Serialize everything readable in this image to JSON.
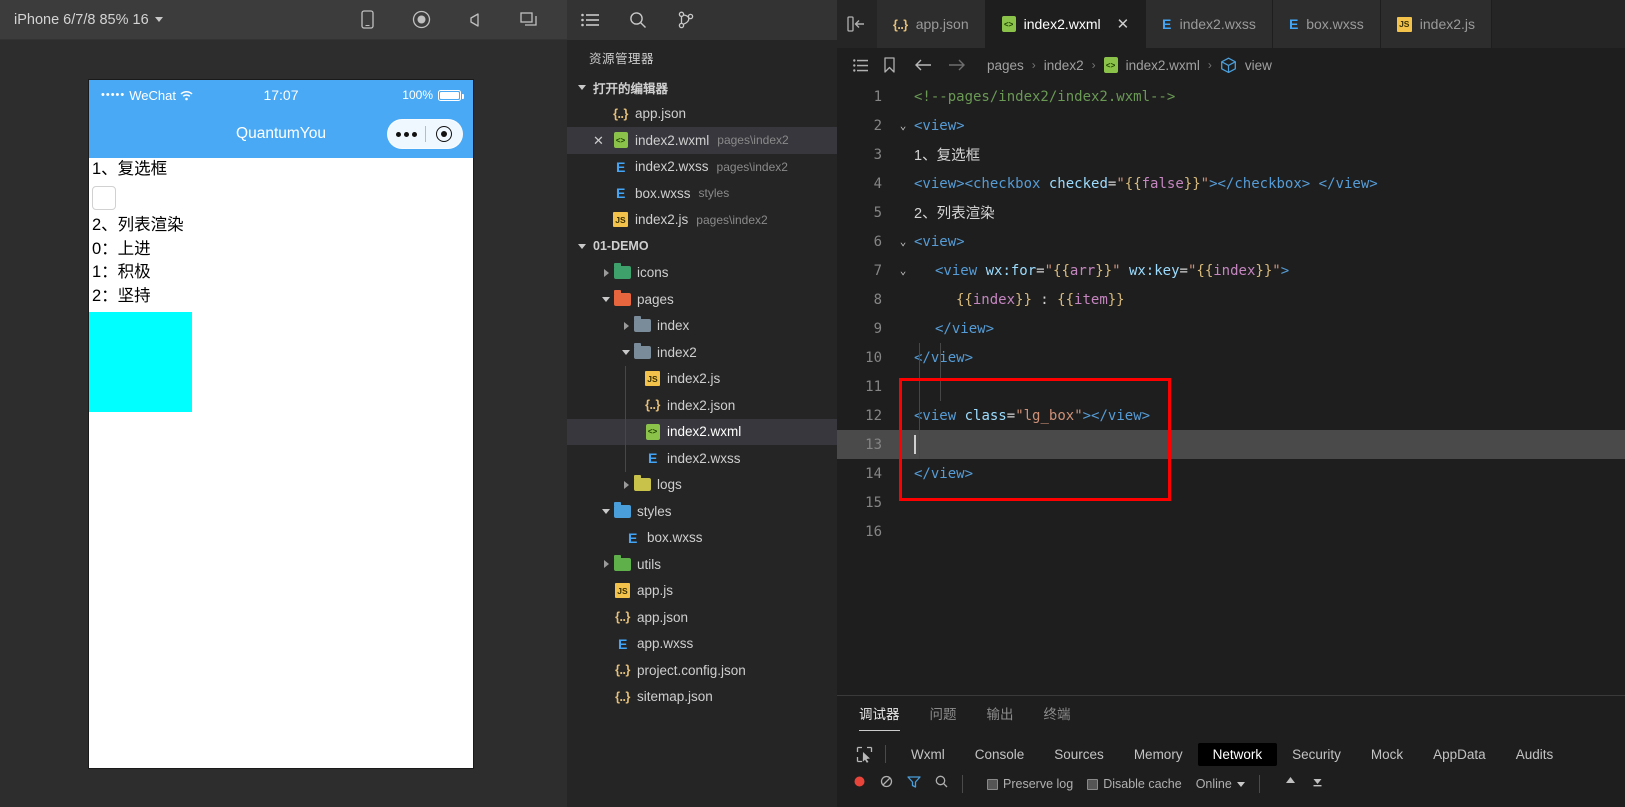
{
  "simulator": {
    "device_label": "iPhone 6/7/8 85% 16",
    "toolbar_icons": [
      "phone-icon",
      "record-icon",
      "volume-icon",
      "windows-icon"
    ],
    "phone": {
      "status": {
        "dots": "•••••",
        "carrier": "WeChat",
        "wifi": "ᵛ",
        "time": "17:07",
        "battery": "100%"
      },
      "nav": {
        "title": "QuantumYou"
      },
      "content": {
        "heading1": "1、复选框",
        "heading2": "2、列表渲染",
        "list": [
          "0：上进",
          "1：积极",
          "2：坚持"
        ]
      }
    }
  },
  "explorer": {
    "activity_icons": [
      "list-icon",
      "search-icon",
      "source-control-icon"
    ],
    "collapse_icon": "collapse-sidebar-icon",
    "title": "资源管理器",
    "open_editors": {
      "label": "打开的编辑器",
      "items": [
        {
          "name": "app.json",
          "detail": "",
          "icon": "json-icon",
          "selected": false,
          "close": false
        },
        {
          "name": "index2.wxml",
          "detail": "pages\\index2",
          "icon": "wxml-icon",
          "selected": true,
          "close": true
        },
        {
          "name": "index2.wxss",
          "detail": "pages\\index2",
          "icon": "wxss-icon",
          "selected": false,
          "close": false
        },
        {
          "name": "box.wxss",
          "detail": "styles",
          "icon": "wxss-icon",
          "selected": false,
          "close": false
        },
        {
          "name": "index2.js",
          "detail": "pages\\index2",
          "icon": "js-icon",
          "selected": false,
          "close": false
        }
      ]
    },
    "project": {
      "label": "01-DEMO",
      "items": [
        {
          "name": "icons",
          "type": "folder",
          "indent": 1,
          "state": "collapsed",
          "color": "#3ea06a",
          "icon": "folder-icons"
        },
        {
          "name": "pages",
          "type": "folder",
          "indent": 1,
          "state": "expanded",
          "color": "#e8663d",
          "icon": "folder-pages"
        },
        {
          "name": "index",
          "type": "folder",
          "indent": 2,
          "state": "collapsed",
          "color": "#7a8b9a",
          "icon": "folder-index"
        },
        {
          "name": "index2",
          "type": "folder",
          "indent": 2,
          "state": "expanded",
          "color": "#7a8b9a",
          "icon": "folder-index2"
        },
        {
          "name": "index2.js",
          "type": "js",
          "indent": 3,
          "state": "none",
          "icon": "js-icon"
        },
        {
          "name": "index2.json",
          "type": "json",
          "indent": 3,
          "state": "none",
          "icon": "json-icon"
        },
        {
          "name": "index2.wxml",
          "type": "wxml",
          "indent": 3,
          "state": "none",
          "icon": "wxml-icon",
          "selected": true
        },
        {
          "name": "index2.wxss",
          "type": "wxss",
          "indent": 3,
          "state": "none",
          "icon": "wxss-icon"
        },
        {
          "name": "logs",
          "type": "folder",
          "indent": 2,
          "state": "collapsed",
          "color": "#c9c24a",
          "icon": "folder-logs"
        },
        {
          "name": "styles",
          "type": "folder",
          "indent": 1,
          "state": "expanded",
          "color": "#4a9eda",
          "icon": "folder-styles"
        },
        {
          "name": "box.wxss",
          "type": "wxss",
          "indent": 2,
          "state": "none",
          "icon": "wxss-icon"
        },
        {
          "name": "utils",
          "type": "folder",
          "indent": 1,
          "state": "collapsed",
          "color": "#5fb04a",
          "icon": "folder-utils"
        },
        {
          "name": "app.js",
          "type": "js",
          "indent": 1,
          "state": "none",
          "icon": "js-icon"
        },
        {
          "name": "app.json",
          "type": "json",
          "indent": 1,
          "state": "none",
          "icon": "json-icon"
        },
        {
          "name": "app.wxss",
          "type": "wxss",
          "indent": 1,
          "state": "none",
          "icon": "wxss-icon"
        },
        {
          "name": "project.config.json",
          "type": "json",
          "indent": 1,
          "state": "none",
          "icon": "json-icon"
        },
        {
          "name": "sitemap.json",
          "type": "json",
          "indent": 1,
          "state": "none",
          "icon": "json-icon"
        }
      ]
    }
  },
  "editor": {
    "tabs": [
      {
        "label": "app.json",
        "icon": "json-icon",
        "active": false,
        "closable": false
      },
      {
        "label": "index2.wxml",
        "icon": "wxml-icon",
        "active": true,
        "closable": true,
        "close_glyph": "✕"
      },
      {
        "label": "index2.wxss",
        "icon": "wxss-icon",
        "active": false,
        "closable": false
      },
      {
        "label": "box.wxss",
        "icon": "wxss-icon",
        "active": false,
        "closable": false
      },
      {
        "label": "index2.js",
        "icon": "js-icon",
        "active": false,
        "closable": false
      }
    ],
    "breadcrumb": {
      "icons": [
        "outline-icon",
        "bookmark-icon",
        "back-arrow-icon",
        "forward-arrow-icon"
      ],
      "path": [
        "pages",
        "index2",
        "index2.wxml",
        "view"
      ],
      "separator": "›"
    },
    "code_lines": [
      {
        "n": 1,
        "fold": "",
        "indent": 0,
        "tokens": [
          {
            "t": "cmt",
            "v": "<!--pages/index2/index2.wxml-->"
          }
        ]
      },
      {
        "n": 2,
        "fold": "v",
        "indent": 0,
        "tokens": [
          {
            "t": "tag",
            "v": "<view>"
          }
        ]
      },
      {
        "n": 3,
        "fold": "",
        "indent": 0,
        "tokens": [
          {
            "t": "txt",
            "v": "1、复选框"
          }
        ]
      },
      {
        "n": 4,
        "fold": "",
        "indent": 0,
        "tokens": [
          {
            "t": "tag",
            "v": "<view><checkbox"
          },
          {
            "t": "txt",
            "v": " "
          },
          {
            "t": "attr",
            "v": "checked"
          },
          {
            "t": "punc",
            "v": "="
          },
          {
            "t": "str",
            "v": "\""
          },
          {
            "t": "brace",
            "v": "{{"
          },
          {
            "t": "kw",
            "v": "false"
          },
          {
            "t": "brace",
            "v": "}}"
          },
          {
            "t": "str",
            "v": "\""
          },
          {
            "t": "tag",
            "v": "></checkbox>"
          },
          {
            "t": "txt",
            "v": " "
          },
          {
            "t": "tag",
            "v": "</view>"
          }
        ]
      },
      {
        "n": 5,
        "fold": "",
        "indent": 0,
        "tokens": [
          {
            "t": "txt",
            "v": "2、列表渲染"
          }
        ]
      },
      {
        "n": 6,
        "fold": "v",
        "indent": 0,
        "tokens": [
          {
            "t": "tag",
            "v": "<view>"
          }
        ]
      },
      {
        "n": 7,
        "fold": "v",
        "indent": 1,
        "tokens": [
          {
            "t": "tag",
            "v": "<view"
          },
          {
            "t": "txt",
            "v": " "
          },
          {
            "t": "attr",
            "v": "wx:for"
          },
          {
            "t": "punc",
            "v": "="
          },
          {
            "t": "str",
            "v": "\""
          },
          {
            "t": "brace",
            "v": "{{"
          },
          {
            "t": "kw",
            "v": "arr"
          },
          {
            "t": "brace",
            "v": "}}"
          },
          {
            "t": "str",
            "v": "\""
          },
          {
            "t": "txt",
            "v": " "
          },
          {
            "t": "attr",
            "v": "wx:key"
          },
          {
            "t": "punc",
            "v": "="
          },
          {
            "t": "str",
            "v": "\""
          },
          {
            "t": "brace",
            "v": "{{"
          },
          {
            "t": "kw",
            "v": "index"
          },
          {
            "t": "brace",
            "v": "}}"
          },
          {
            "t": "str",
            "v": "\""
          },
          {
            "t": "tag",
            "v": ">"
          }
        ]
      },
      {
        "n": 8,
        "fold": "",
        "indent": 2,
        "tokens": [
          {
            "t": "brace",
            "v": "{{"
          },
          {
            "t": "kw",
            "v": "index"
          },
          {
            "t": "brace",
            "v": "}}"
          },
          {
            "t": "txt",
            "v": " : "
          },
          {
            "t": "brace",
            "v": "{{"
          },
          {
            "t": "kw",
            "v": "item"
          },
          {
            "t": "brace",
            "v": "}}"
          }
        ]
      },
      {
        "n": 9,
        "fold": "",
        "indent": 1,
        "tokens": [
          {
            "t": "tag",
            "v": "</view>"
          }
        ]
      },
      {
        "n": 10,
        "fold": "",
        "indent": 0,
        "tokens": [
          {
            "t": "tag",
            "v": "</view>"
          }
        ]
      },
      {
        "n": 11,
        "fold": "",
        "indent": 0,
        "tokens": []
      },
      {
        "n": 12,
        "fold": "",
        "indent": 0,
        "tokens": [
          {
            "t": "tag",
            "v": "<view"
          },
          {
            "t": "txt",
            "v": " "
          },
          {
            "t": "attr",
            "v": "class"
          },
          {
            "t": "punc",
            "v": "="
          },
          {
            "t": "str",
            "v": "\"lg_box\""
          },
          {
            "t": "tag",
            "v": "></view>"
          }
        ]
      },
      {
        "n": 13,
        "fold": "",
        "indent": 0,
        "current": true,
        "caret": true,
        "tokens": []
      },
      {
        "n": 14,
        "fold": "",
        "indent": 0,
        "tokens": [
          {
            "t": "tag",
            "v": "</view>"
          }
        ]
      },
      {
        "n": 15,
        "fold": "",
        "indent": 0,
        "tokens": []
      },
      {
        "n": 16,
        "fold": "",
        "indent": 0,
        "tokens": []
      }
    ],
    "highlight_box": {
      "from_line": 11,
      "to_line": 15,
      "color": "#ff0000"
    }
  },
  "panel": {
    "tabs": [
      {
        "label": "调试器",
        "active": true
      },
      {
        "label": "问题",
        "active": false
      },
      {
        "label": "输出",
        "active": false
      },
      {
        "label": "终端",
        "active": false
      }
    ],
    "devtools": {
      "inspect_icon": "inspect-cursor-icon",
      "tabs": [
        {
          "label": "Wxml",
          "active": false
        },
        {
          "label": "Console",
          "active": false
        },
        {
          "label": "Sources",
          "active": false
        },
        {
          "label": "Memory",
          "active": false
        },
        {
          "label": "Network",
          "active": true
        },
        {
          "label": "Security",
          "active": false
        },
        {
          "label": "Mock",
          "active": false
        },
        {
          "label": "AppData",
          "active": false
        },
        {
          "label": "Audits",
          "active": false
        }
      ],
      "toolbar": {
        "record_icon": "record-red-icon",
        "clear_icon": "clear-icon",
        "filter_icon": "filter-icon",
        "search_icon": "search-icon",
        "preserve_log": "Preserve log",
        "disable_cache": "Disable cache",
        "throttle": "Online",
        "import_icon": "import-arrow-icon",
        "export_icon": "export-arrow-icon"
      }
    }
  },
  "colors": {
    "accent_blue": "#49a9f5",
    "cyan_box": "#00ffff",
    "editor_bg": "#1e1e1e",
    "sidebar_bg": "#252526",
    "highlight_red": "#ff0000",
    "active_tab_black": "#000000"
  }
}
